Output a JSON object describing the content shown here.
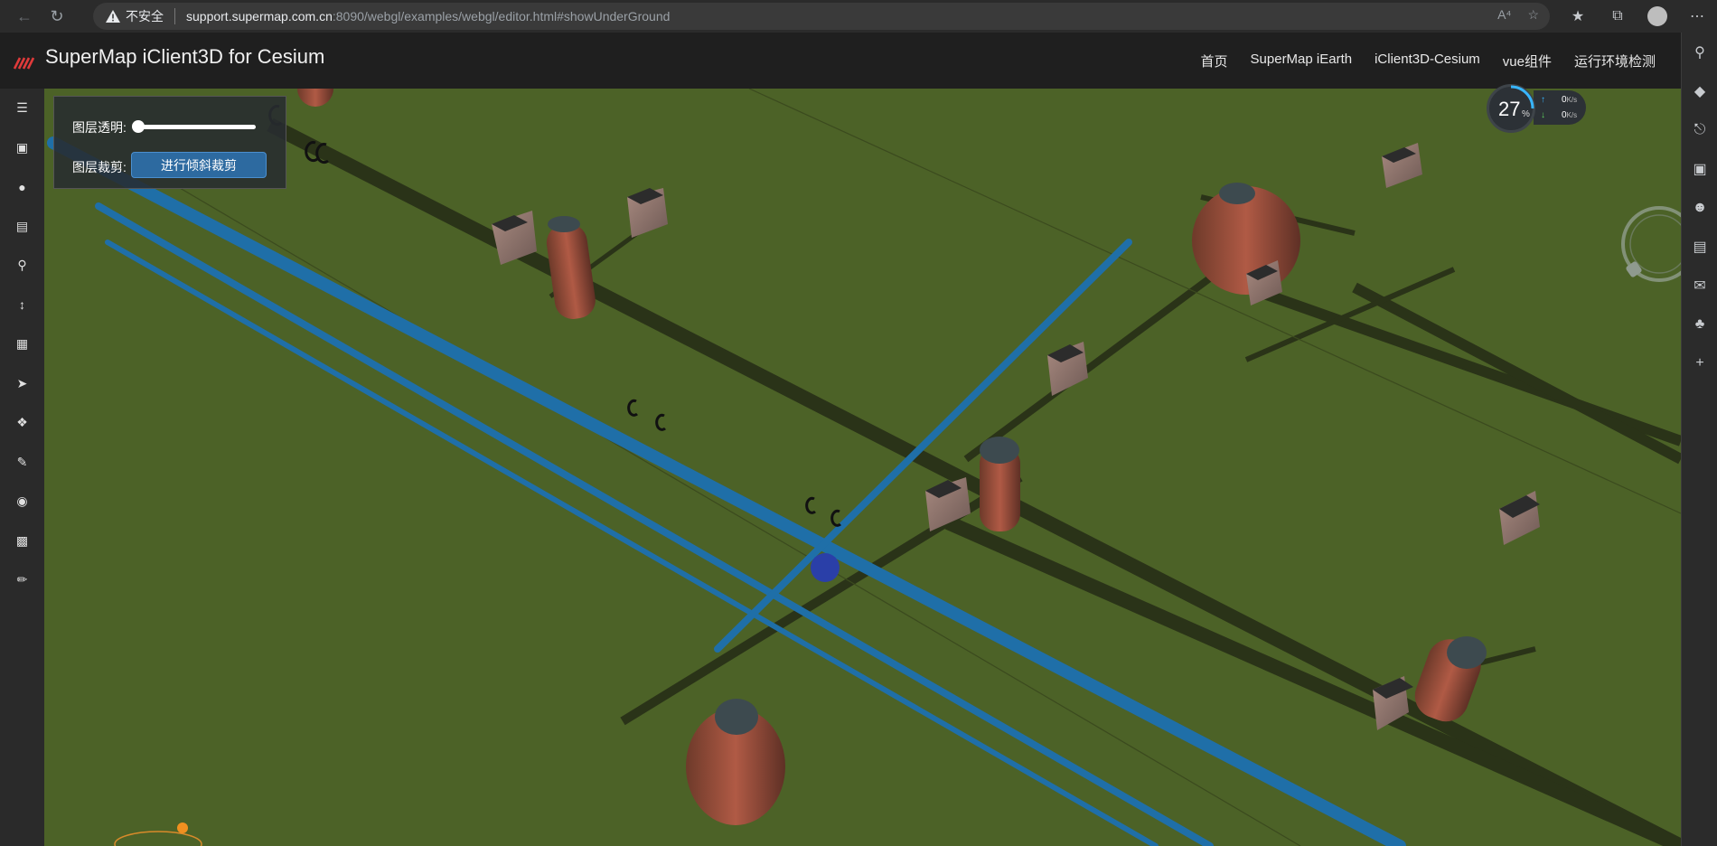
{
  "browser": {
    "security_label": "不安全",
    "url_host": "support.supermap.com.cn",
    "url_rest": ":8090/webgl/examples/webgl/editor.html#showUnderGround"
  },
  "app": {
    "title": "SuperMap iClient3D for Cesium",
    "nav": [
      "首页",
      "SuperMap iEarth",
      "iClient3D-Cesium",
      "vue组件",
      "运行环境检测"
    ]
  },
  "tools": [
    "layers-icon",
    "scene-icon",
    "globe-icon",
    "bank-icon",
    "search-icon",
    "measure-height-icon",
    "map-icon",
    "send-icon",
    "cubes-icon",
    "edit-icon",
    "eye-icon",
    "box-icon",
    "pencil-icon"
  ],
  "layer_panel": {
    "opacity_label": "图层透明:",
    "opacity_value": 0,
    "clip_label": "图层裁剪:",
    "clip_button": "进行倾斜裁剪"
  },
  "fps_widget": {
    "value": "27",
    "unit": "%",
    "upload": "0",
    "download": "0",
    "rate_unit": "K/s"
  },
  "colors": {
    "ground": "#4c6227",
    "pipe_blue": "#1f6fa8",
    "header_bg": "#1f1f1f",
    "button_blue": "#2d6aa0"
  }
}
